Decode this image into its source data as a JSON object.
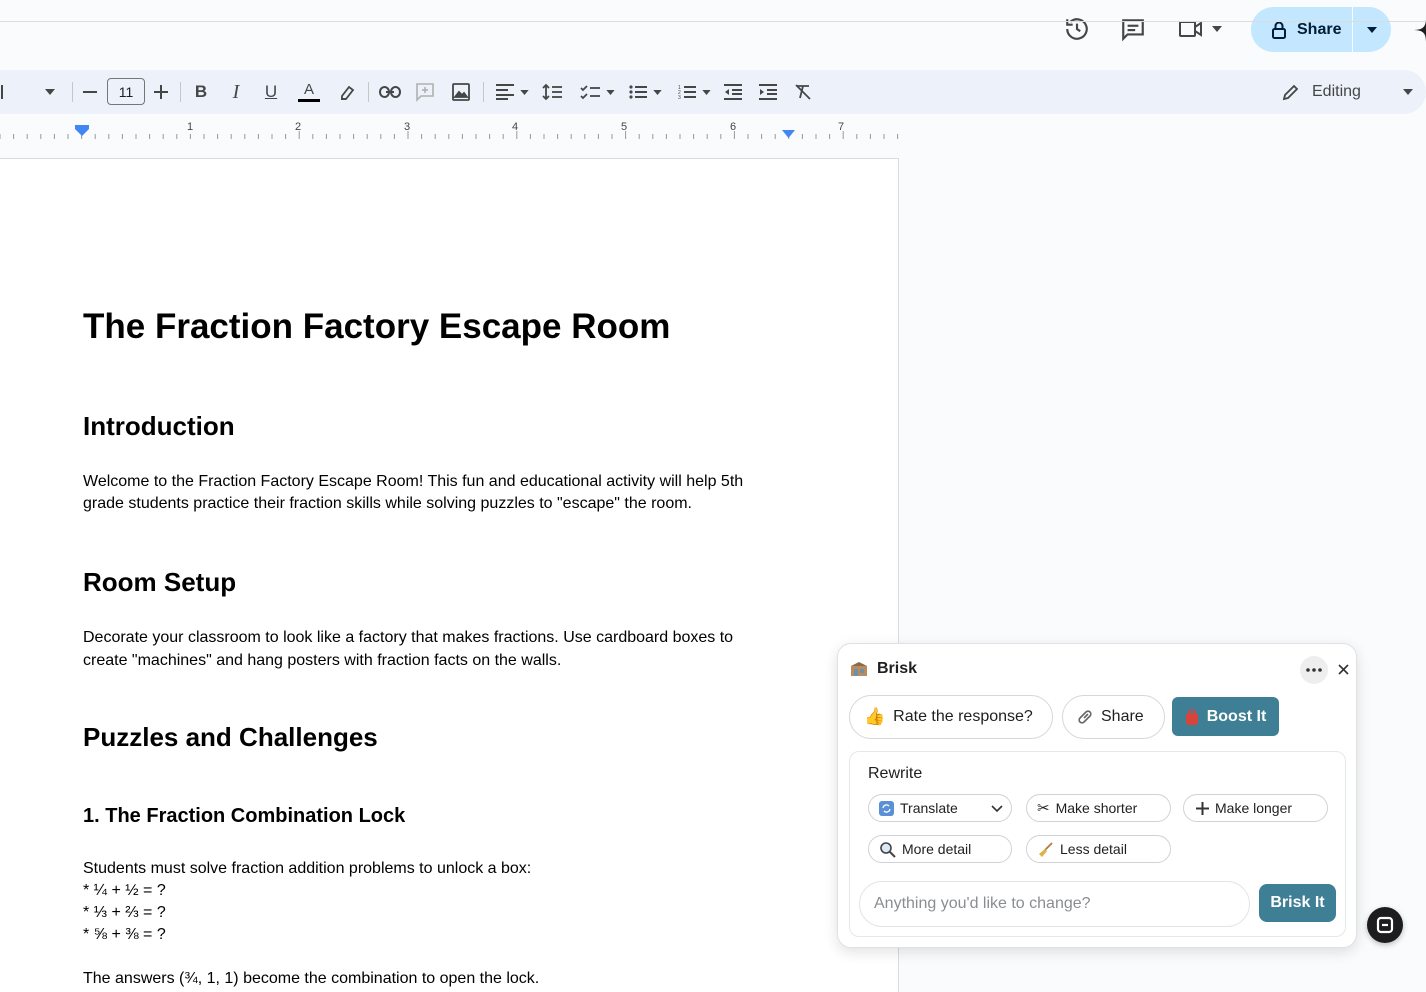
{
  "header": {
    "share_label": "Share",
    "icons": [
      "history-icon",
      "comments-icon",
      "meet-icon",
      "lock-icon",
      "gemini-icon"
    ]
  },
  "toolbar": {
    "font_size": "11",
    "bold_label": "B",
    "italic_label": "I",
    "underline_label": "U",
    "text_color_label": "A",
    "mode_label": "Editing"
  },
  "ruler": {
    "marks": [
      "1",
      "2",
      "3",
      "4",
      "5",
      "6",
      "7"
    ]
  },
  "document": {
    "title": "The Fraction Factory Escape Room",
    "intro_heading": "Introduction",
    "intro_text_1": "Welcome to the Fraction Factory Escape Room! This fun and educational activity will help 5th",
    "intro_text_2": "grade students practice their fraction skills while solving puzzles to \"escape\" the room.",
    "setup_heading": "Room Setup",
    "setup_text_1": "Decorate your classroom to look like a factory that makes fractions. Use cardboard boxes to",
    "setup_text_2": "create \"machines\" and hang posters with fraction facts on the walls.",
    "puzzles_heading": "Puzzles and Challenges",
    "lock_heading": "1. The Fraction Combination Lock",
    "lock_intro": "Students must solve fraction addition problems to unlock a box:",
    "problems": [
      "* ¼ + ½ = ?",
      "* ⅓ + ⅔ = ?",
      "* ⅝ + ⅜ = ?"
    ],
    "answers_text": "The answers (¾, 1, 1) become the combination to open the lock."
  },
  "brisk": {
    "title": "Brisk",
    "rate_label": "Rate the response?",
    "share_label": "Share",
    "boost_label": "Boost It",
    "rewrite_label": "Rewrite",
    "translate_label": "Translate",
    "shorter_label": "Make shorter",
    "longer_label": "Make longer",
    "more_detail_label": "More detail",
    "less_detail_label": "Less detail",
    "input_placeholder": "Anything you'd like to change?",
    "submit_label": "Brisk It"
  },
  "colors": {
    "share_bg": "#c2e7ff",
    "toolbar_bg": "#edf2fa",
    "brisk_accent": "#3f7f95",
    "ruler_marker": "#4285f4"
  }
}
